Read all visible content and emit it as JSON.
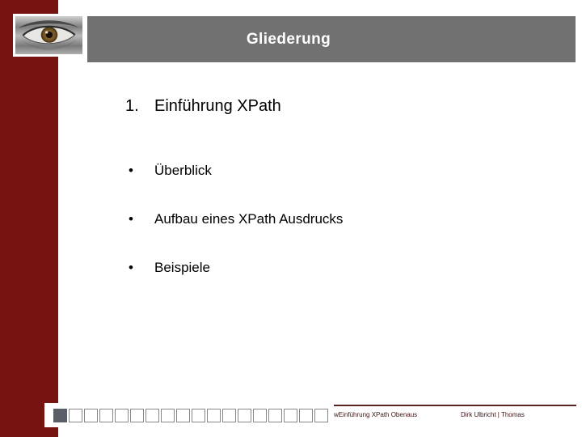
{
  "slide": {
    "title": "Gliederung",
    "colors": {
      "sidebar_maroon": "#771310",
      "header_gray": "#717171",
      "footer_line": "#5c2323",
      "square_filled": "#5a5e66",
      "square_outline": "#888888",
      "title_text": "#ffffff",
      "body_text": "#000000",
      "footer_text": "#3f1313"
    }
  },
  "content": {
    "numbered_items": [
      {
        "number": "1.",
        "text": "Einführung XPath"
      }
    ],
    "bullets": [
      {
        "marker": "•",
        "text": "Überblick"
      },
      {
        "marker": "•",
        "text": "Aufbau eines XPath Ausdrucks"
      },
      {
        "marker": "•",
        "text": "Beispiele"
      }
    ]
  },
  "footer": {
    "left_text": "wEinführung XPath Obenaus",
    "right_text": "Dirk Ulbricht |  Thomas",
    "progress_squares": {
      "total": 18,
      "filled": 1
    }
  }
}
